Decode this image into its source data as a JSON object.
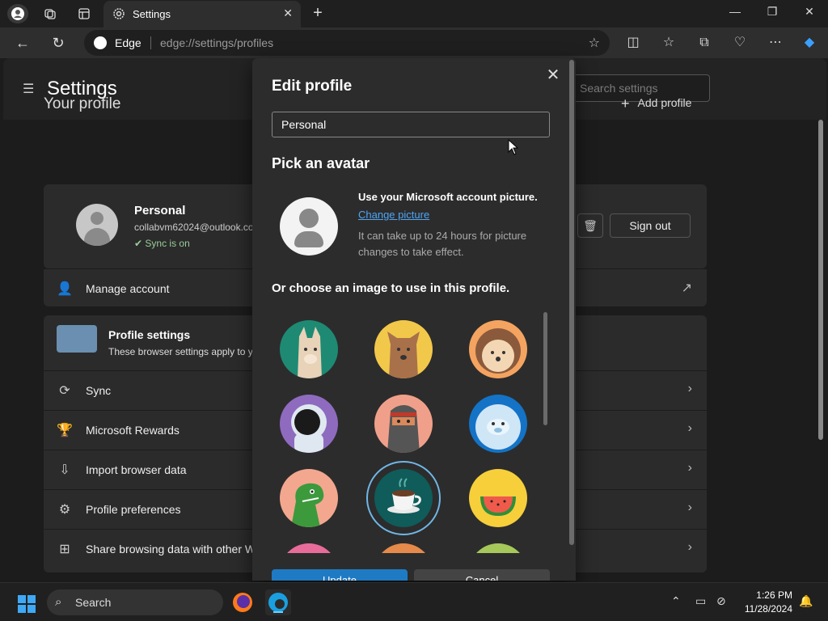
{
  "browser": {
    "tab_title": "Settings",
    "site_label": "Edge",
    "url": "edge://settings/profiles"
  },
  "settings": {
    "title": "Settings",
    "search_placeholder": "Search settings",
    "your_profile": "Your profile",
    "add_profile": "Add profile",
    "profile": {
      "name": "Personal",
      "email": "collabvm62024@outlook.co",
      "sync_status": "Sync is on",
      "sign_out": "Sign out"
    },
    "manage_account": "Manage account",
    "profile_settings": {
      "title": "Profile settings",
      "subtitle": "These browser settings apply to y"
    },
    "rows": [
      {
        "label": "Sync",
        "icon": "sync-icon"
      },
      {
        "label": "Microsoft Rewards",
        "icon": "trophy-icon"
      },
      {
        "label": "Import browser data",
        "icon": "import-icon"
      },
      {
        "label": "Profile preferences",
        "icon": "people-gear-icon"
      },
      {
        "label": "Share browsing data with other W",
        "icon": "windows-icon"
      }
    ]
  },
  "modal": {
    "title": "Edit profile",
    "name_value": "Personal",
    "pick_avatar": "Pick an avatar",
    "ms_heading": "Use your Microsoft account picture.",
    "change_picture": "Change picture",
    "ms_desc": "It can take up to 24 hours for picture changes to take effect.",
    "choose_image": "Or choose an image to use in this profile.",
    "avatars": [
      "llama",
      "dog",
      "hedgehog",
      "astronaut",
      "ninja",
      "yeti",
      "dinosaur",
      "coffee-cup",
      "watermelon"
    ],
    "selected_avatar": "coffee-cup",
    "save_label": "Update",
    "cancel_label": "Cancel"
  },
  "taskbar": {
    "search_label": "Search",
    "time": "1:26 PM",
    "date": "11/28/2024"
  }
}
